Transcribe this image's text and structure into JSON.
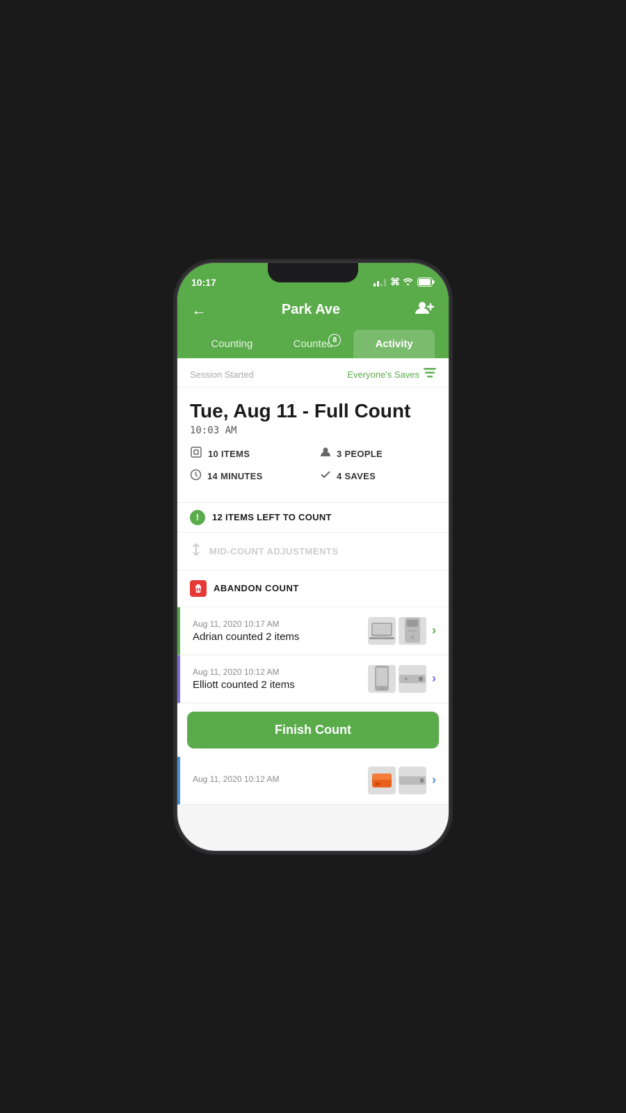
{
  "statusBar": {
    "time": "10:17",
    "signalBars": [
      2,
      3,
      4
    ],
    "wifi": "wifi",
    "battery": "battery"
  },
  "header": {
    "backLabel": "←",
    "title": "Park Ave",
    "addPeopleIcon": "+👤"
  },
  "tabs": [
    {
      "id": "counting",
      "label": "Counting",
      "badge": null,
      "active": false
    },
    {
      "id": "counted",
      "label": "Counted",
      "badge": 8,
      "active": false
    },
    {
      "id": "activity",
      "label": "Activity",
      "badge": null,
      "active": true
    }
  ],
  "sessionHeader": {
    "label": "Session Started",
    "filterLabel": "Everyone's Saves",
    "filterIcon": "≡"
  },
  "sessionInfo": {
    "title": "Tue, Aug 11 - Full Count",
    "time": "10:03 AM",
    "stats": [
      {
        "icon": "⊙",
        "value": "10 ITEMS"
      },
      {
        "icon": "👤",
        "value": "3 PEOPLE"
      },
      {
        "icon": "⏱",
        "value": "14 MINUTES"
      },
      {
        "icon": "✓",
        "value": "4 SAVES"
      }
    ]
  },
  "itemsLeft": {
    "count": "12",
    "text": "ITEMS LEFT TO COUNT"
  },
  "midCount": {
    "label": "MID-COUNT ADJUSTMENTS"
  },
  "abandonCount": {
    "label": "ABANDON COUNT"
  },
  "activityItems": [
    {
      "accent": "green",
      "date": "Aug 11, 2020 10:17 AM",
      "description": "Adrian counted 2 items"
    },
    {
      "accent": "purple",
      "date": "Aug 11, 2020 10:12 AM",
      "description": "Elliott counted 2 items"
    },
    {
      "accent": "blue",
      "date": "Aug 11, 2020 10:12 AM",
      "description": ""
    }
  ],
  "finishButton": {
    "label": "Finish Count"
  },
  "colors": {
    "green": "#5aab4a",
    "purple": "#7c6bdb",
    "blue": "#4a90d9",
    "red": "#e53935"
  }
}
